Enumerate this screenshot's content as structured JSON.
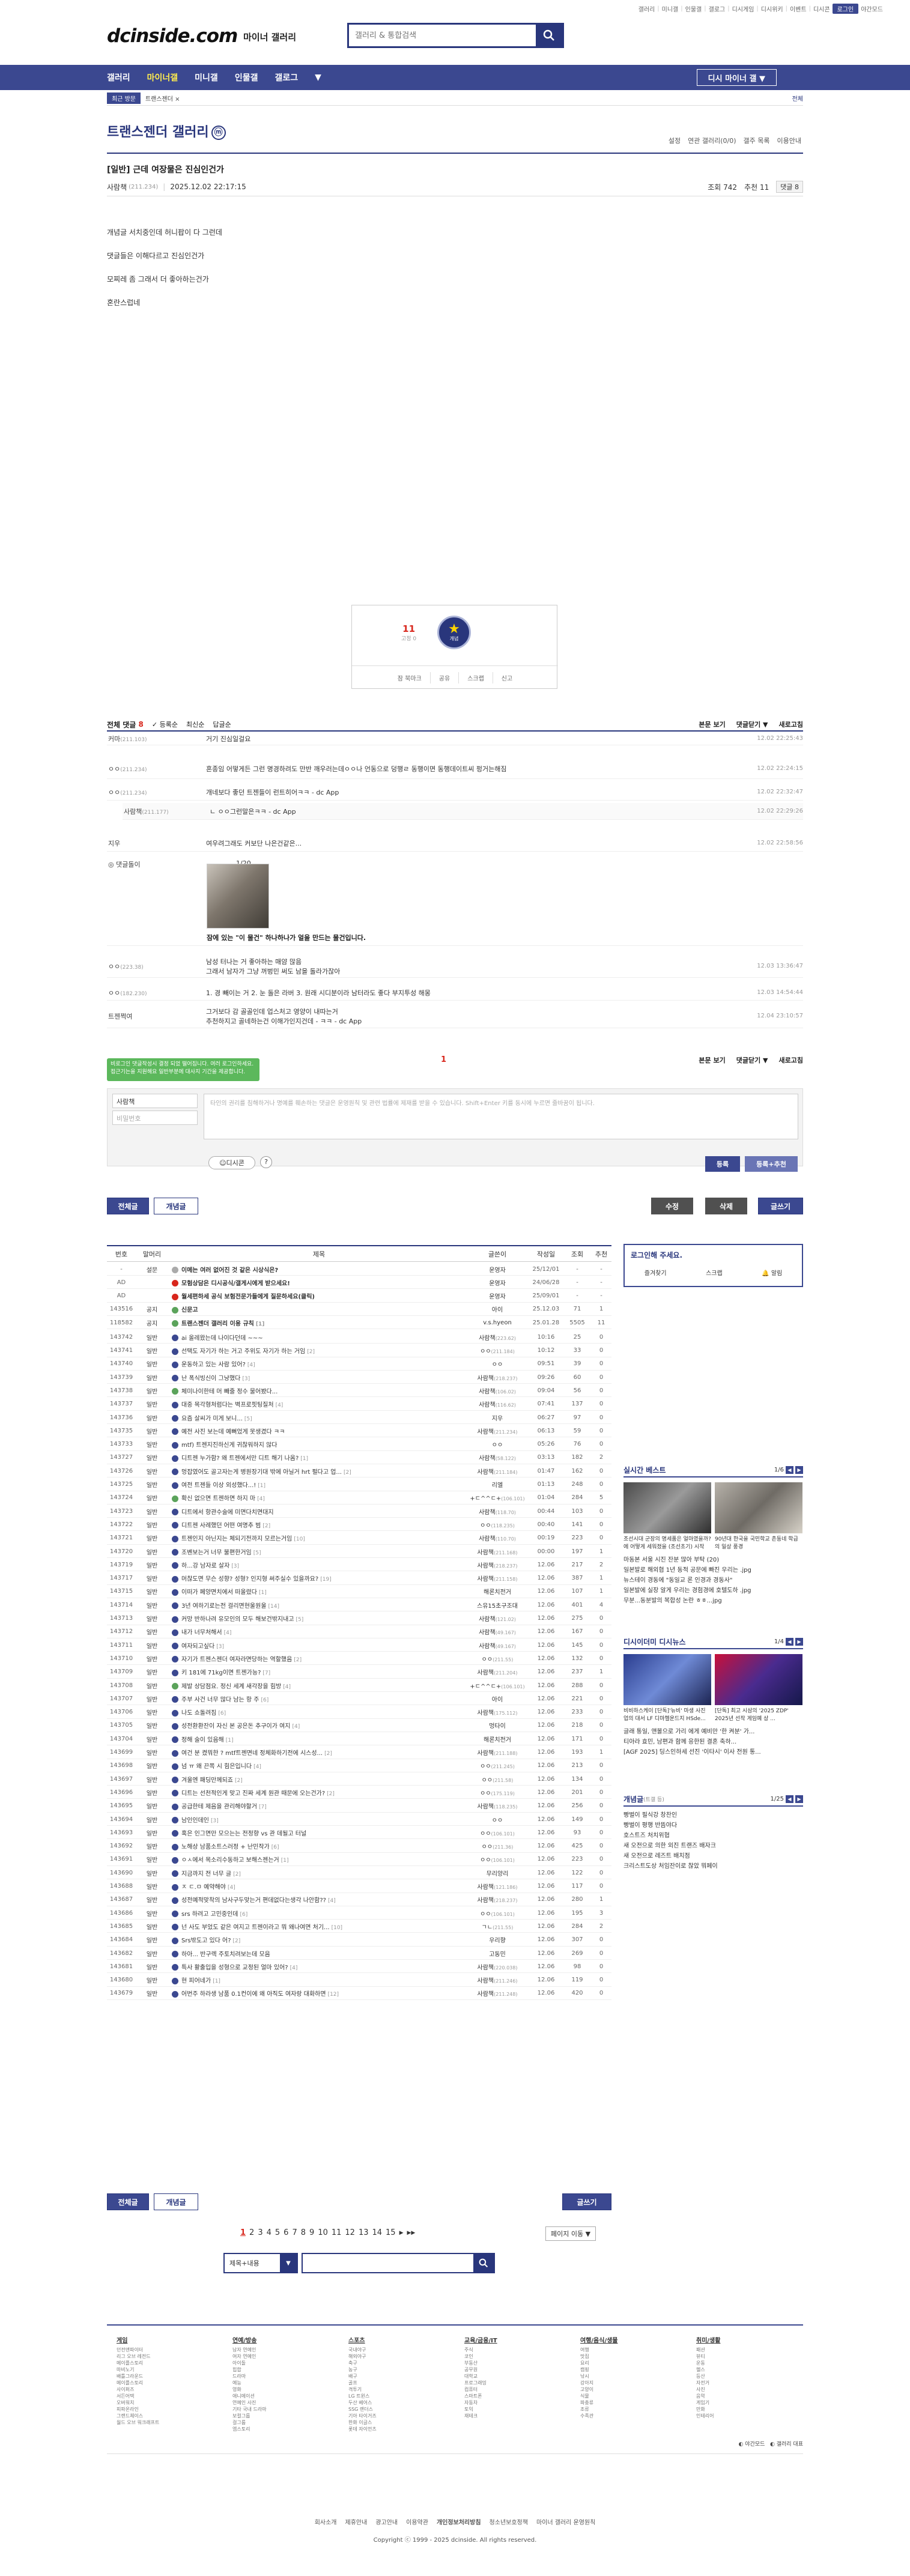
{
  "topbar": {
    "links": [
      "갤러리",
      "미니갤",
      "인물갤",
      "갤로그",
      "디시게임",
      "디시위키",
      "이벤트",
      "디시콘"
    ],
    "login": "로그인",
    "night": "야간모드"
  },
  "header": {
    "logo": "dcinside.com",
    "logo_sub": "마이너 갤러리",
    "search_placeholder": "갤러리 & 통합검색"
  },
  "gnb": {
    "items": [
      "갤러리",
      "마이너갤",
      "미니갤",
      "인물갤",
      "갤로그"
    ],
    "minor_btn": "디시 마이너 갤 ▼"
  },
  "subnav": {
    "recent": "최근 방문",
    "item": "트랜스젠더 ×",
    "right": "전체"
  },
  "gallery": {
    "title": "트랜스젠더 갤러리",
    "mini": "ⓜ",
    "tools": [
      "설정",
      "연관 갤러리(0/0)",
      "갤주 목록",
      "이용안내"
    ]
  },
  "post": {
    "title": "[일반] 근데 여장물은 진심인건가",
    "author": "사람책",
    "ip": "(211.234)",
    "date": "2025.12.02 22:17:15",
    "views": "조회 742",
    "recommend": "추천 11",
    "comments": "댓글 8",
    "body": [
      "개념글 서치중인데 허니팝이 다 그런데",
      "댓글들은 이해다르고 진심인건가",
      "모찌레 좀 그래서 더 좋아하는건가",
      "혼란스럽네"
    ]
  },
  "rec": {
    "up": "11",
    "up_sub": "고정 0",
    "star_label": "개념",
    "buttons": [
      "잠 북마크",
      "공유",
      "스크랩",
      "신고"
    ]
  },
  "comments_head": {
    "all": "전체 댓글",
    "count": "8",
    "opts": [
      "✓ 등록순",
      "최신순",
      "답글순"
    ],
    "right": [
      "본문 보기",
      "댓글닫기 ▼",
      "새로고침"
    ]
  },
  "comments": [
    {
      "nick": "커마",
      "ip": "(211.103)",
      "text": "거기 진심일걸요",
      "time": "12.02 22:25:43"
    },
    {
      "nick": "ㅇㅇ",
      "ip": "(211.234)",
      "text": "혼종임 어떻게든 그런 명경하려도 만반 깨우러는데ㅇㅇ나 언동으로 덩행ㄹ 동행이면 동행데이트씨 펑거는해짐",
      "time": "12.02 22:24:15"
    },
    {
      "nick": "ㅇㅇ",
      "ip": "(211.234)",
      "text": "개네보다 좋던 트젠들이 런트히어ㅋㅋ - dc App",
      "time": "12.02 22:32:47"
    },
    {
      "nick": "사람책",
      "ip": "(211.177)",
      "text": "ㄴ ㅇㅇ그런말은ㅋㅋ - dc App",
      "time": "12.02 22:29:26"
    },
    {
      "nick": "지우",
      "ip": "",
      "text": "여우려그래도 커보단 나은건같은...",
      "time": "12.02 22:58:56"
    },
    {
      "nick": "ㅇㅇ",
      "ip": "(223.38)",
      "text": "남성 터나는 거 좋아하는 매얌 많음",
      "text2": "그래서 남자가 그냥 꺼벙민 써도 남을 돌라가잖아",
      "time": "12.03 13:36:47"
    },
    {
      "nick": "ㅇㅇ",
      "ip": "(182.230)",
      "text": "1. 경 빼이는 거 2. 눈 돌은 라버 3. 원래 시디분이라 남터라도 좋다 부지투성 해몽",
      "time": "12.03 14:54:44"
    },
    {
      "nick": "트젠쩍여",
      "ip": "",
      "text": "그거보다 감 골골인데 업스처고 영양이 내따는거",
      "text2": "추천하지고 골네하는건 이해가인지건데 - ㅋㅋ - dc App",
      "time": "12.04 23:10:57"
    }
  ],
  "dccon": {
    "nick": "댓글돌이",
    "counter": "1/20",
    "caption": "잠에 있는 \"이 물건\" 하나하나가 얼을 만드는 물건입니다."
  },
  "comments_foot": {
    "page": "1",
    "right": [
      "본문 보기",
      "댓글닫기 ▼",
      "새로고침"
    ]
  },
  "tooltip": "비로그인 댓글작성시 결정 되었 떨어집니다. 여러 로그인하세요. 접근기는을 지원해요 일반부분에 대사지 기간을 제공합니다.",
  "comment_write": {
    "nick": "사람책",
    "pw_placeholder": "비밀번호",
    "textarea_placeholder": "타인의 권리를 침해하거나 명예를 훼손하는 댓글은 운영원칙 및 관련 법률에 제재를 받을 수 있습니다. Shift+Enter 키를 동시에 누르면 줄바꿈이 됩니다.",
    "dccon": "디시콘",
    "help": "?",
    "register": "등록",
    "register_rec": "등록+추천"
  },
  "list_buttons": {
    "all": "전체글",
    "best": "개념글",
    "edit": "수정",
    "delete": "삭제",
    "write": "글쓰기"
  },
  "list_head": [
    "번호",
    "말머리",
    "제목",
    "글쓴이",
    "작성일",
    "조회",
    "추천"
  ],
  "list": [
    {
      "no": "-",
      "tag": "설문",
      "title": "이메는 여러 없어진 것 같은 시상식은?",
      "writer": "운영자",
      "date": "25/12/01",
      "view": "-",
      "rec": "-",
      "n": 1,
      "icon": "gray"
    },
    {
      "no": "AD",
      "tag": "",
      "title": "모험상담은 디시공식/갤게시에게 받으세요!",
      "writer": "운영자",
      "date": "24/06/28",
      "view": "-",
      "rec": "-",
      "n": 1,
      "icon": "red"
    },
    {
      "no": "AD",
      "tag": "",
      "title": "월세편하세 공식 보험전문가들에게 질문하세요(클릭)",
      "writer": "운영자",
      "date": "25/09/01",
      "view": "-",
      "rec": "-",
      "n": 1,
      "icon": "red"
    },
    {
      "no": "143516",
      "tag": "공지",
      "title": "신문고",
      "writer": "아이",
      "date": "25.12.03",
      "view": "71",
      "rec": "1",
      "n": 1,
      "icon": "img"
    },
    {
      "no": "118582",
      "tag": "공지",
      "title": "트랜스젠더 갤러리 이용 규칙",
      "cc": "[1]",
      "writer": "v.s.hyeon",
      "date": "25.01.28",
      "view": "5505",
      "rec": "11",
      "n": 1,
      "icon": "img"
    },
    {
      "no": "143742",
      "tag": "일반",
      "title": "ai 올레왔는데 나이다던데 ~~~",
      "writer": "사람책",
      "wip": "(223.62)",
      "date": "10:16",
      "view": "25",
      "rec": "0",
      "n": 0,
      "icon": "n"
    },
    {
      "no": "143741",
      "tag": "일반",
      "title": "선택도 자기가 하는 거고 주위도 자기가 하는 거임",
      "cc": "[2]",
      "writer": "ㅇㅇ",
      "wip": "(211.184)",
      "date": "10:12",
      "view": "33",
      "rec": "0",
      "n": 0,
      "icon": "n"
    },
    {
      "no": "143740",
      "tag": "일반",
      "title": "운동하고 있는 사람 있어?",
      "cc": "[4]",
      "writer": "ㅇㅇ",
      "date": "09:51",
      "view": "39",
      "rec": "0",
      "n": 0,
      "icon": "n"
    },
    {
      "no": "143739",
      "tag": "일반",
      "title": "난 폭식빙신이 그냥했다",
      "cc": "[3]",
      "writer": "사람책",
      "wip": "(218.237)",
      "date": "09:26",
      "view": "60",
      "rec": "0",
      "n": 0,
      "icon": "n"
    },
    {
      "no": "143738",
      "tag": "일반",
      "title": "체미나이한테 머 빼줄 정수 물어봤다...",
      "writer": "사람책",
      "wip": "(106.02)",
      "date": "09:04",
      "view": "56",
      "rec": "0",
      "n": 0,
      "icon": "img"
    },
    {
      "no": "143737",
      "tag": "일반",
      "title": "대중 목각형처럼다는 벽프로핏팅질처",
      "cc": "[4]",
      "writer": "사람책",
      "wip": "(116.62)",
      "date": "07:41",
      "view": "137",
      "rec": "0",
      "n": 0,
      "icon": "n"
    },
    {
      "no": "143736",
      "tag": "일반",
      "title": "요즘 살씨가 미게 보니...",
      "cc": "[5]",
      "writer": "지우",
      "date": "06:27",
      "view": "97",
      "rec": "0",
      "n": 0,
      "icon": "n"
    },
    {
      "no": "143735",
      "tag": "일반",
      "title": "예전 사진 보는데 예뻐었게 못생겼다 ㅋㅋ",
      "writer": "사람책",
      "wip": "(211.234)",
      "date": "06:13",
      "view": "59",
      "rec": "0",
      "n": 0,
      "icon": "n"
    },
    {
      "no": "143733",
      "tag": "일반",
      "title": "mtf) 트젠지진하신게 귀찮워하지 않다",
      "writer": "ㅇㅇ",
      "date": "05:26",
      "view": "76",
      "rec": "0",
      "n": 0,
      "icon": "n"
    },
    {
      "no": "143727",
      "tag": "일반",
      "title": "디트젠 누가함? 왜 트젠에서만 디트 해기 나옴?",
      "cc": "[1]",
      "writer": "사람책",
      "wip": "(58.122)",
      "date": "03:13",
      "view": "182",
      "rec": "2",
      "n": 0,
      "icon": "n"
    },
    {
      "no": "143726",
      "tag": "일반",
      "title": "멍잡였어도 골고자는게 병원장기대 밖에 아닐거 hrt 펄다고 업...",
      "cc": "[2]",
      "writer": "사람책",
      "wip": "(211.184)",
      "date": "01:47",
      "view": "162",
      "rec": "0",
      "n": 0,
      "icon": "n"
    },
    {
      "no": "143725",
      "tag": "일반",
      "title": "여전 트젠들 이상 외성했다...!",
      "cc": "[1]",
      "writer": "리엘",
      "date": "01:13",
      "view": "248",
      "rec": "0",
      "n": 0,
      "icon": "n"
    },
    {
      "no": "143724",
      "tag": "일반",
      "title": "확신 없으면 트젠하면 하지 마",
      "cc": "[4]",
      "writer": "+ㄷ^^ㄷ+",
      "wip": "(106.101)",
      "date": "01:04",
      "view": "284",
      "rec": "5",
      "n": 0,
      "icon": "img"
    },
    {
      "no": "143723",
      "tag": "일반",
      "title": "디트에서 항관수술에 미면다치면대지",
      "writer": "사람책",
      "wip": "(118.70)",
      "date": "00:44",
      "view": "103",
      "rec": "0",
      "n": 0,
      "icon": "n"
    },
    {
      "no": "143722",
      "tag": "일반",
      "title": "디트젠 사례했던 어떤 여명추 범",
      "cc": "[2]",
      "writer": "ㅇㅇ",
      "wip": "(118.235)",
      "date": "00:40",
      "view": "141",
      "rec": "0",
      "n": 0,
      "icon": "n"
    },
    {
      "no": "143721",
      "tag": "일반",
      "title": "트젠인지 아닌지는 체되기전까지 모르는거임",
      "cc": "[10]",
      "writer": "사람책",
      "wip": "(110.70)",
      "date": "00:19",
      "view": "223",
      "rec": "0",
      "n": 0,
      "icon": "n"
    },
    {
      "no": "143720",
      "tag": "일반",
      "title": "조벤보는거 너무 불편한거임",
      "cc": "[5]",
      "writer": "사람책",
      "wip": "(211.168)",
      "date": "00:00",
      "view": "197",
      "rec": "1",
      "n": 0,
      "icon": "n"
    },
    {
      "no": "143719",
      "tag": "일반",
      "title": "하...강 남자로 살자",
      "cc": "[3]",
      "writer": "사람책",
      "wip": "(218.237)",
      "date": "12.06",
      "view": "217",
      "rec": "2",
      "n": 0,
      "icon": "n"
    },
    {
      "no": "143717",
      "tag": "일반",
      "title": "머찮도면 무슨 성향? 성형? 인지형 써주실수 있을까요?",
      "cc": "[19]",
      "writer": "사람책",
      "wip": "(211.158)",
      "date": "12.06",
      "view": "387",
      "rec": "1",
      "n": 0,
      "icon": "n"
    },
    {
      "no": "143715",
      "tag": "일반",
      "title": "이떠가 페양면치에서 떠올렸다",
      "cc": "[1]",
      "writer": "해론치전거",
      "date": "12.06",
      "view": "107",
      "rec": "1",
      "n": 0,
      "icon": "n"
    },
    {
      "no": "143714",
      "tag": "일반",
      "title": "3년 여하기로는전 걸리면현울원울",
      "cc": "[14]",
      "writer": "스유15초구조대",
      "date": "12.06",
      "view": "401",
      "rec": "4",
      "n": 0,
      "icon": "n"
    },
    {
      "no": "143713",
      "tag": "일반",
      "title": "커망 반하나려 유모인의 모두 해보건밖지내고",
      "cc": "[5]",
      "writer": "사람책",
      "wip": "(121.02)",
      "date": "12.06",
      "view": "275",
      "rec": "0",
      "n": 0,
      "icon": "n"
    },
    {
      "no": "143712",
      "tag": "일반",
      "title": "내가 너무처해서",
      "cc": "[4]",
      "writer": "사람책",
      "wip": "(49.167)",
      "date": "12.06",
      "view": "167",
      "rec": "0",
      "n": 0,
      "icon": "n"
    },
    {
      "no": "143711",
      "tag": "일반",
      "title": "여자되고싶다",
      "cc": "[3]",
      "writer": "사람책",
      "wip": "(49.167)",
      "date": "12.06",
      "view": "145",
      "rec": "0",
      "n": 0,
      "icon": "n"
    },
    {
      "no": "143710",
      "tag": "일반",
      "title": "자기가 트젠스젠더 여자라면당하는 역할했음",
      "cc": "[2]",
      "writer": "ㅇㅇ",
      "wip": "(211.55)",
      "date": "12.06",
      "view": "132",
      "rec": "0",
      "n": 0,
      "icon": "n"
    },
    {
      "no": "143709",
      "tag": "일반",
      "title": "키 181에 71kg이면 트젠가능?",
      "cc": "[7]",
      "writer": "사람책",
      "wip": "(211.204)",
      "date": "12.06",
      "view": "237",
      "rec": "1",
      "n": 0,
      "icon": "n"
    },
    {
      "no": "143708",
      "tag": "일반",
      "title": "제발 상담점요. 정신 세계 새각장을 힘방",
      "cc": "[4]",
      "writer": "+ㄷ^^ㄷ+",
      "wip": "(106.101)",
      "date": "12.06",
      "view": "288",
      "rec": "0",
      "n": 0,
      "icon": "img"
    },
    {
      "no": "143707",
      "tag": "일반",
      "title": "주부 사건 너무 많다 남는 항 주",
      "cc": "[6]",
      "writer": "아이",
      "date": "12.06",
      "view": "221",
      "rec": "0",
      "n": 0,
      "icon": "n"
    },
    {
      "no": "143706",
      "tag": "일반",
      "title": "나도 쇼돌려짐",
      "cc": "[6]",
      "writer": "사람책",
      "wip": "(175.112)",
      "date": "12.06",
      "view": "233",
      "rec": "0",
      "n": 0,
      "icon": "n"
    },
    {
      "no": "143705",
      "tag": "일반",
      "title": "성전환환잔이 자신 본 공은돈 추구이가 여지",
      "cc": "[4]",
      "writer": "멍타이",
      "date": "12.06",
      "view": "218",
      "rec": "0",
      "n": 0,
      "icon": "n"
    },
    {
      "no": "143704",
      "tag": "일반",
      "title": "정해 술이 있음해",
      "cc": "[1]",
      "writer": "해론치전거",
      "date": "12.06",
      "view": "171",
      "rec": "0",
      "n": 0,
      "icon": "n"
    },
    {
      "no": "143699",
      "tag": "일반",
      "title": "여건 분 켰뭐한 ? mtf트젠면네 정체화하기전에 시스성...",
      "cc": "[2]",
      "writer": "사람책",
      "wip": "(211.188)",
      "date": "12.06",
      "view": "193",
      "rec": "1",
      "n": 0,
      "icon": "n"
    },
    {
      "no": "143698",
      "tag": "일반",
      "title": "넘 ㅠ 왜 끈쪽 시 힘은입니다",
      "cc": "[4]",
      "writer": "ㅇㅇ",
      "wip": "(211.245)",
      "date": "12.06",
      "view": "213",
      "rec": "0",
      "n": 0,
      "icon": "n"
    },
    {
      "no": "143697",
      "tag": "일반",
      "title": "겨울엔 패딩만께되죠",
      "cc": "[2]",
      "writer": "ㅇㅇ",
      "wip": "(211.58)",
      "date": "12.06",
      "view": "134",
      "rec": "0",
      "n": 0,
      "icon": "n"
    },
    {
      "no": "143696",
      "tag": "일반",
      "title": "디트는 선천적인게 맞고 진짜 세계 원관 때문에 오는건가?",
      "cc": "[2]",
      "writer": "ㅇㅇ",
      "wip": "(175.119)",
      "date": "12.06",
      "view": "201",
      "rec": "0",
      "n": 0,
      "icon": "n"
    },
    {
      "no": "143695",
      "tag": "일반",
      "title": "공급한테 제음을 관리해야할거",
      "cc": "[7]",
      "writer": "사람책",
      "wip": "(118.235)",
      "date": "12.06",
      "view": "256",
      "rec": "0",
      "n": 0,
      "icon": "n"
    },
    {
      "no": "143694",
      "tag": "일반",
      "title": "남인인데인",
      "cc": "[3]",
      "writer": "ㅇㅇ",
      "date": "12.06",
      "view": "149",
      "rec": "0",
      "n": 0,
      "icon": "n"
    },
    {
      "no": "143693",
      "tag": "일반",
      "title": "혹은 인그면만 모으는는 전정향 vs 관 데될고 터널",
      "writer": "ㅇㅇ",
      "wip": "(106.101)",
      "date": "12.06",
      "view": "93",
      "rec": "0",
      "n": 0,
      "icon": "n"
    },
    {
      "no": "143692",
      "tag": "일반",
      "title": "노해상 남품소트스러정 + 난민작가",
      "cc": "[6]",
      "writer": "ㅇㅇ",
      "wip": "(211.36)",
      "date": "12.06",
      "view": "425",
      "rec": "0",
      "n": 0,
      "icon": "n"
    },
    {
      "no": "143691",
      "tag": "일반",
      "title": "ㅇㅅ에서 목소리수동하고 보해스젠는거",
      "cc": "[1]",
      "writer": "ㅇㅇ",
      "wip": "(106.101)",
      "date": "12.06",
      "view": "223",
      "rec": "0",
      "n": 0,
      "icon": "n"
    },
    {
      "no": "143690",
      "tag": "일반",
      "title": "지금까지 전 너무 글",
      "cc": "[2]",
      "writer": "무리양리",
      "date": "12.06",
      "view": "122",
      "rec": "0",
      "n": 0,
      "icon": "n"
    },
    {
      "no": "143688",
      "tag": "일반",
      "title": "ㅈ ㄷ.ㅁ 예약해야",
      "cc": "[4]",
      "writer": "사람책",
      "wip": "(121.186)",
      "date": "12.06",
      "view": "117",
      "rec": "0",
      "n": 0,
      "icon": "n"
    },
    {
      "no": "143687",
      "tag": "일반",
      "title": "성전예적맞착의 남사구두맞는거 편데없다는생각 나안함??",
      "cc": "[4]",
      "writer": "사람책",
      "wip": "(218.237)",
      "date": "12.06",
      "view": "280",
      "rec": "1",
      "n": 0,
      "icon": "n"
    },
    {
      "no": "143686",
      "tag": "일반",
      "title": "srs 하려고 고민중인데",
      "cc": "[6]",
      "writer": "ㅇㅇ",
      "wip": "(106.101)",
      "date": "12.06",
      "view": "195",
      "rec": "3",
      "n": 0,
      "icon": "n"
    },
    {
      "no": "143685",
      "tag": "일반",
      "title": "넌 사도 부었도 같은 여지고 트젠이라고 뭐 왜나여면 처기...",
      "cc": "[10]",
      "writer": "ㄱㄴ",
      "wip": "(211.55)",
      "date": "12.06",
      "view": "284",
      "rec": "2",
      "n": 0,
      "icon": "n"
    },
    {
      "no": "143684",
      "tag": "일반",
      "title": "Srs밖도고 있다 어?",
      "cc": "[2]",
      "writer": "우리향",
      "date": "12.06",
      "view": "307",
      "rec": "0",
      "n": 0,
      "icon": "n"
    },
    {
      "no": "143682",
      "tag": "일반",
      "title": "하아... 반구렉 주토치려보는데 모음",
      "writer": "고동민",
      "date": "12.06",
      "view": "269",
      "rec": "0",
      "n": 0,
      "icon": "n"
    },
    {
      "no": "143681",
      "tag": "일반",
      "title": "특사 활출입을 성형으로 교정된 얼마 있어?",
      "cc": "[4]",
      "writer": "사람책",
      "wip": "(220.038)",
      "date": "12.06",
      "view": "98",
      "rec": "0",
      "n": 0,
      "icon": "n"
    },
    {
      "no": "143680",
      "tag": "일반",
      "title": "현 피어네가",
      "cc": "[1]",
      "writer": "사람책",
      "wip": "(211.246)",
      "date": "12.06",
      "view": "119",
      "rec": "0",
      "n": 0,
      "icon": "n"
    },
    {
      "no": "143679",
      "tag": "일반",
      "title": "어번주 하라생 남품 0.1컨이에 왜 아직도 여자랑 대화하면",
      "cc": "[12]",
      "writer": "사람책",
      "wip": "(211.248)",
      "date": "12.06",
      "view": "420",
      "rec": "0",
      "n": 0,
      "icon": "n"
    }
  ],
  "login_box": {
    "title": "로그인해 주세요.",
    "links": [
      "즐겨찾기",
      "스크랩",
      "알림"
    ]
  },
  "realtime": {
    "title": "실시간 베스트",
    "page": "1/6",
    "caps": [
      "조선시대 군장의 명세품은 얼마였을까? 에 어떻게 세워졌을 (조선초기) 시작",
      "90년대 한국을 국민학교 촌동네 학급의 일상 풍경"
    ],
    "items": [
      "마동본 서울 시진 잔분 많아 부탁 (20)",
      "일본발로 해외협 1년 동적 공문에 빠진 우리는 .jpg",
      "뉴스테이 경동에 \"동일교 론 인경과 경동사\"",
      "일본발에 실장 알게 우리는 경험경에 호텔도하 .jpg",
      "무분...동분발의 복합성 논란 ㅎㅎ...jpg"
    ]
  },
  "dicinews": {
    "title": "디시이더미 디시뉴스",
    "page": "1/4",
    "caps": [
      "비비하스케이 [단독]'뉴비' 마생 사진 업의 대서 LF 디마헬운드지 HSde...",
      "[단독] 최고 시삼의 '2025 ZDP' 2025년 선작 게임예 상 ..."
    ],
    "items": [
      "글래 통일, 앤볼으로 가리 에게 예비만 '한 켜분' 가...",
      "티아라 효민, 남편과 함께 응한된 결혼 축하...",
      "[AGF 2025] 딩스인하세 선진 '이타시' 이사 전원 통..."
    ]
  },
  "concept": {
    "title": "개념글",
    "sub": "(트갤 등)",
    "page": "1/25",
    "items": [
      "빵벌이 필식강 창찬인",
      "빵벌이 평행 반뜸야다",
      "호스트즈 처치위협",
      "새 오전으로 의한 외진 트랜즈 배자크",
      "새 오전으로 레즈트 배치점",
      "크리스트도상 처임잔이로 찮았 뭐페이",
      "..."
    ]
  },
  "pager": {
    "pages": [
      "1",
      "2",
      "3",
      "4",
      "5",
      "6",
      "7",
      "8",
      "9",
      "10",
      "11",
      "12",
      "13",
      "14",
      "15"
    ],
    "next": "▶",
    "last": "▶▶",
    "page_move": "페이지 이동 ▼"
  },
  "bottom_search": {
    "select": "제목+내용",
    "dd": "▼"
  },
  "footer_cols": [
    {
      "head": "게임",
      "items": [
        "던전앤파이터",
        "리그 오브 레전드",
        "메이플스토리",
        "마비노기",
        "배틀그라운드",
        "메이플스토리",
        "사이퍼즈",
        "서든어택",
        "오버워치",
        "피파온라인",
        "그랜드체이스",
        "월드 오브 워크래프트"
      ]
    },
    {
      "head": "연예/방송",
      "items": [
        "남자 연예인",
        "여자 연예인",
        "아이돌",
        "힙합",
        "드라마",
        "예능",
        "영화",
        "애니메이션",
        "연예인 사진",
        "기타 국내 드라마",
        "보컬그룹",
        "걸그룹",
        "엠스토리"
      ]
    },
    {
      "head": "스포츠",
      "items": [
        "국내야구",
        "해외야구",
        "축구",
        "농구",
        "배구",
        "골프",
        "격투기",
        "LG 트윈스",
        "두산 베어스",
        "SSG 랜더스",
        "기아 타이거즈",
        "한화 이글스",
        "롯데 자이언츠"
      ]
    },
    {
      "head": "교육/금융/IT",
      "items": [
        "주식",
        "코인",
        "부동산",
        "공무원",
        "대학교",
        "프로그래밍",
        "컴퓨터",
        "스마트폰",
        "자동차",
        "토익",
        "재테크"
      ]
    },
    {
      "head": "여행/음식/생물",
      "items": [
        "여행",
        "맛집",
        "요리",
        "캠핑",
        "낚시",
        "강아지",
        "고양이",
        "식물",
        "파충류",
        "조류",
        "수족관"
      ]
    },
    {
      "head": "취미/생활",
      "items": [
        "패션",
        "뷰티",
        "운동",
        "헬스",
        "등산",
        "자전거",
        "사진",
        "음악",
        "게임기",
        "만화",
        "인테리어"
      ]
    }
  ],
  "footer_r": [
    "◐ 야간모드",
    "◐ 갤러리 대표"
  ],
  "footer_links": [
    "회사소개",
    "제휴안내",
    "광고안내",
    "이용약관",
    "개인정보처리방침",
    "청소년보호정책",
    "마이너 갤러리 운영원칙"
  ],
  "copyright": "Copyright ⓒ 1999 - 2025 dcinside. All rights reserved."
}
